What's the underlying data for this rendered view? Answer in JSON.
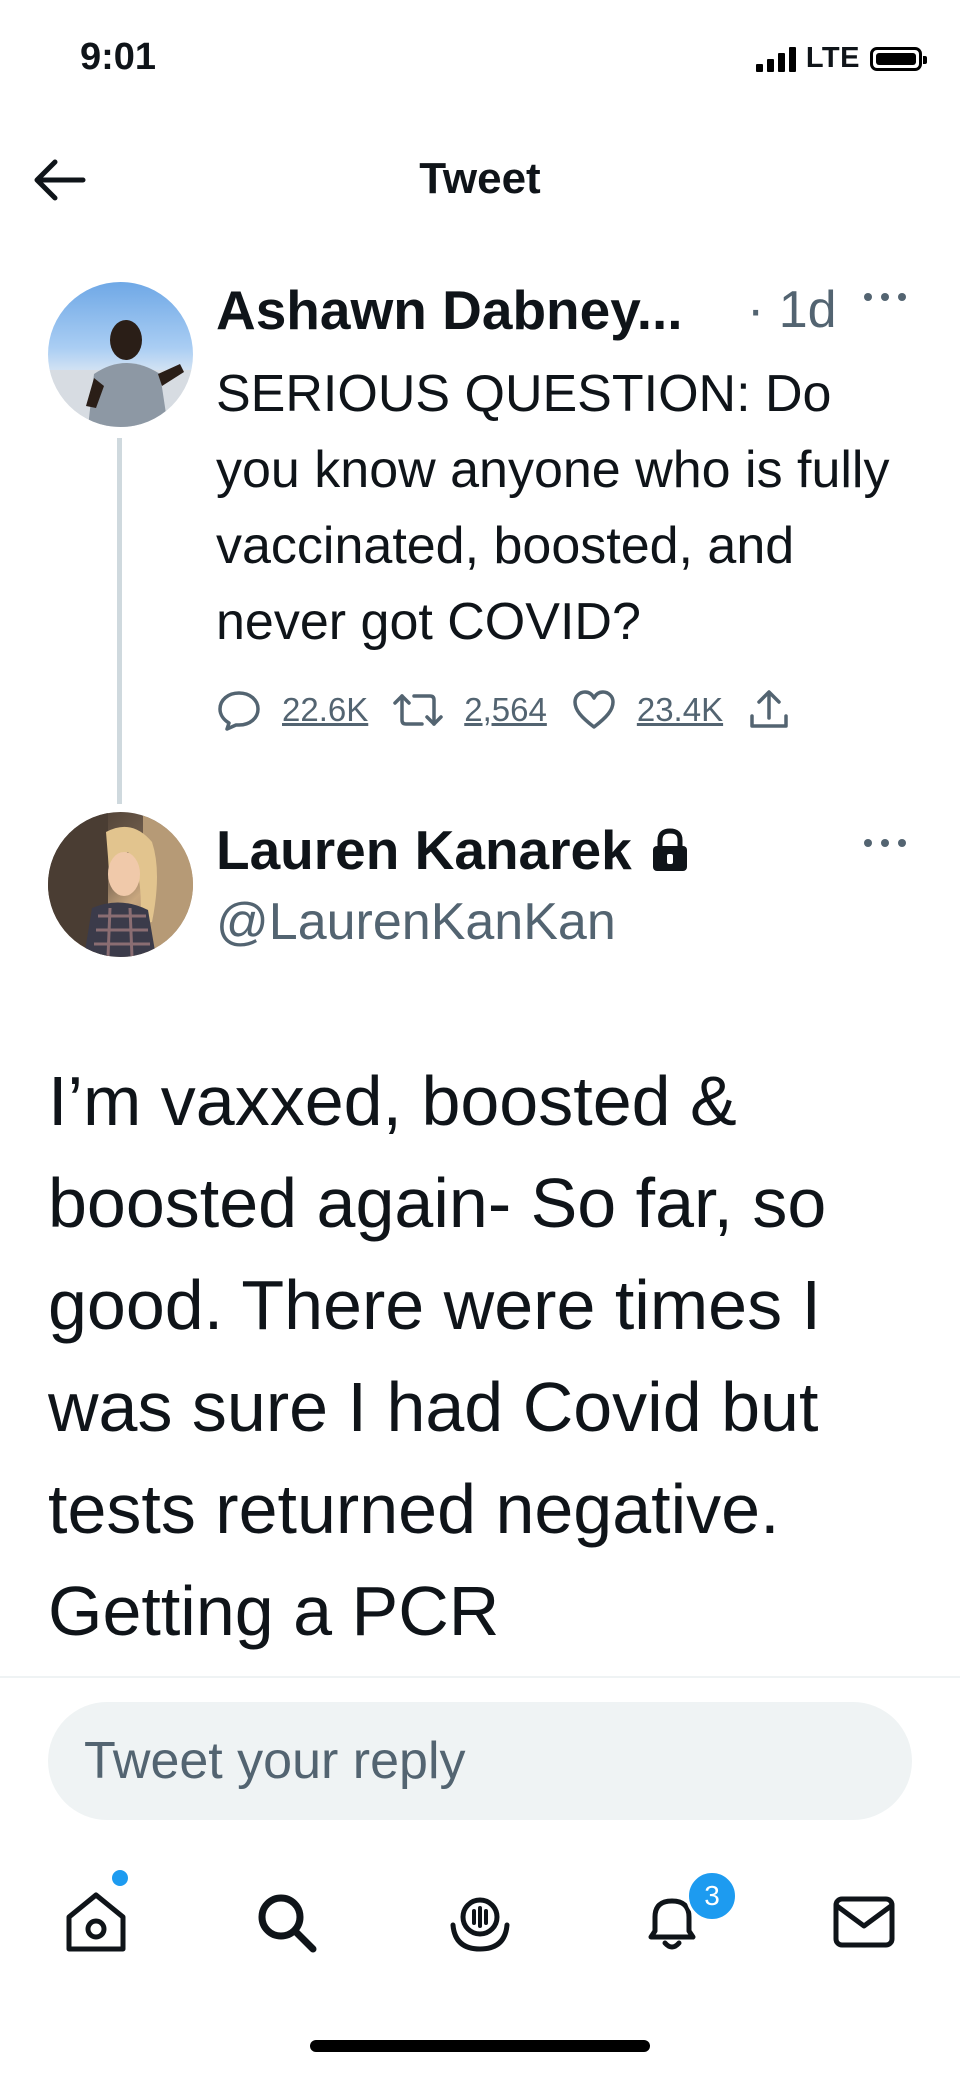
{
  "status_bar": {
    "time": "9:01",
    "network": "LTE"
  },
  "header": {
    "title": "Tweet"
  },
  "tweet": {
    "author_name": "Ashawn Dabney...",
    "age": "· 1d",
    "text": "SERIOUS QUESTION: Do you know anyone who is fully vaccinated, boosted, and never got COVID?",
    "replies": "22.6K",
    "retweets": "2,564",
    "likes": "23.4K"
  },
  "reply": {
    "author_name": "Lauren Kanarek",
    "handle": "@LaurenKanKan",
    "text": "I’m vaxxed, boosted & boosted again- So far, so good. There were times I was sure I had Covid but tests returned negative. Getting a PCR"
  },
  "compose": {
    "placeholder": "Tweet your reply"
  },
  "nav": {
    "notifications_count": "3"
  },
  "colors": {
    "accent": "#1d9bf0",
    "secondary_text": "#536471",
    "divider": "#cfd9de"
  }
}
